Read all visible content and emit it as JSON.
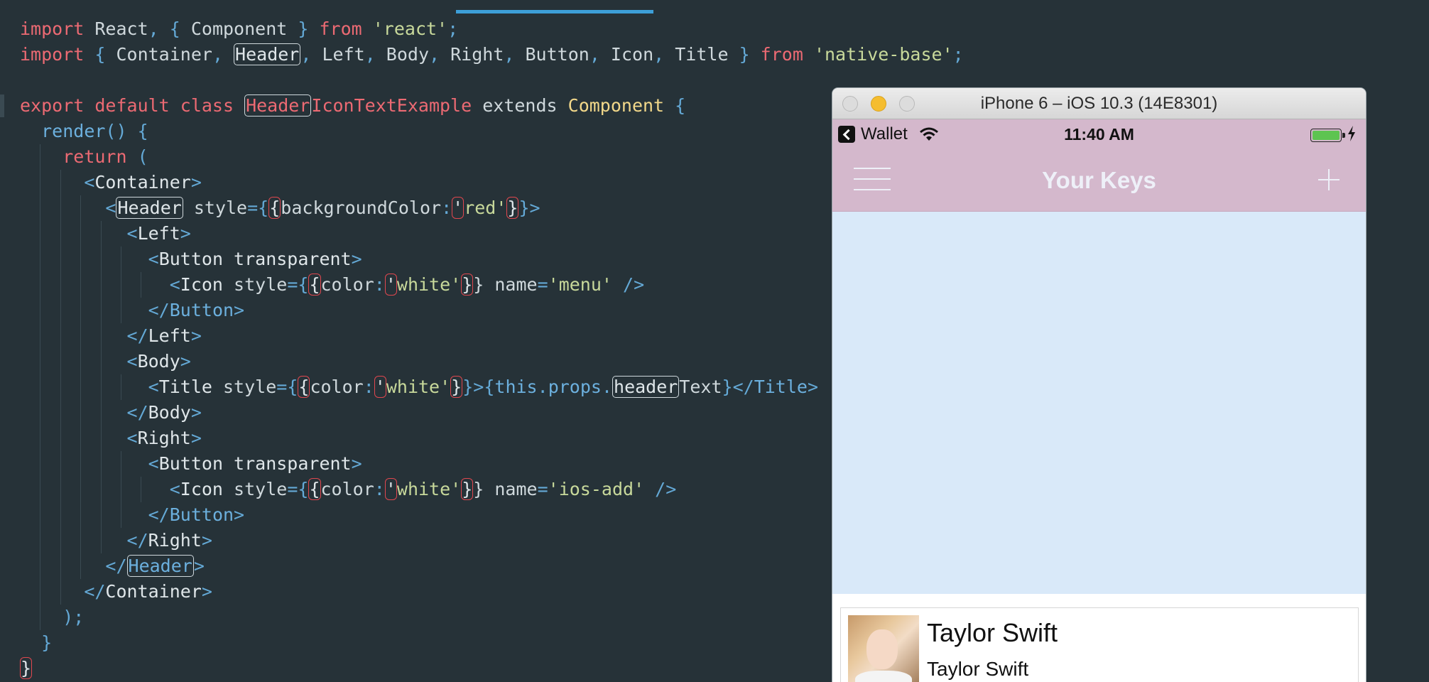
{
  "editor": {
    "lines": [
      [
        [
          "kw",
          "import"
        ],
        [
          "tx",
          " React"
        ],
        [
          "pun",
          ", { "
        ],
        [
          "tx",
          "Component"
        ],
        [
          "pun",
          " } "
        ],
        [
          "kw",
          "from"
        ],
        [
          "tx",
          " "
        ],
        [
          "str",
          "'react'"
        ],
        [
          "pun",
          ";"
        ]
      ],
      [
        [
          "kw",
          "import"
        ],
        [
          "pun",
          " { "
        ],
        [
          "tx",
          "Container"
        ],
        [
          "pun",
          ", "
        ],
        [
          "box",
          "Header"
        ],
        [
          "pun",
          ", "
        ],
        [
          "tx",
          "Left"
        ],
        [
          "pun",
          ", "
        ],
        [
          "tx",
          "Body"
        ],
        [
          "pun",
          ", "
        ],
        [
          "tx",
          "Right"
        ],
        [
          "pun",
          ", "
        ],
        [
          "tx",
          "Button"
        ],
        [
          "pun",
          ", "
        ],
        [
          "tx",
          "Icon"
        ],
        [
          "pun",
          ", "
        ],
        [
          "tx",
          "Title"
        ],
        [
          "pun",
          " } "
        ],
        [
          "kw",
          "from"
        ],
        [
          "tx",
          " "
        ],
        [
          "str",
          "'native-base'"
        ],
        [
          "pun",
          ";"
        ]
      ],
      [],
      [
        [
          "kw",
          "export default class "
        ],
        [
          "hlbox",
          "Header"
        ],
        [
          "kw",
          "IconTextExample"
        ],
        [
          "tx",
          " extends "
        ],
        [
          "cls",
          "Component"
        ],
        [
          "pun",
          " {"
        ]
      ],
      [
        [
          "i1",
          ""
        ],
        [
          "fn",
          "render"
        ],
        [
          "pun",
          "() {"
        ]
      ],
      [
        [
          "i2",
          ""
        ],
        [
          "kw",
          "return"
        ],
        [
          "pun",
          " ("
        ]
      ],
      [
        [
          "i3",
          ""
        ],
        [
          "pun",
          "<"
        ],
        [
          "tag",
          "Container"
        ],
        [
          "pun",
          ">"
        ]
      ],
      [
        [
          "i4",
          ""
        ],
        [
          "pun",
          "<"
        ],
        [
          "box",
          "Header"
        ],
        [
          "tx",
          " style"
        ],
        [
          "pun",
          "="
        ],
        [
          "pun",
          "{"
        ],
        [
          "rbox",
          "{"
        ],
        [
          "tx",
          "backgroundColor"
        ],
        [
          "pun",
          ":"
        ],
        [
          "rbox",
          "'"
        ],
        [
          "str",
          "red"
        ],
        [
          "str",
          "'"
        ],
        [
          "rbox",
          "}"
        ],
        [
          "pun",
          "}>"
        ]
      ],
      [
        [
          "i5",
          ""
        ],
        [
          "pun",
          "<"
        ],
        [
          "tag",
          "Left"
        ],
        [
          "pun",
          ">"
        ]
      ],
      [
        [
          "i6",
          ""
        ],
        [
          "pun",
          "<"
        ],
        [
          "tag",
          "Button transparent"
        ],
        [
          "pun",
          ">"
        ]
      ],
      [
        [
          "i7",
          ""
        ],
        [
          "pun",
          "<"
        ],
        [
          "tag",
          "Icon"
        ],
        [
          "tx",
          " style"
        ],
        [
          "pun",
          "="
        ],
        [
          "pun",
          "{"
        ],
        [
          "rbox",
          "{"
        ],
        [
          "tx",
          "color"
        ],
        [
          "pun",
          ":"
        ],
        [
          "rbox",
          "'"
        ],
        [
          "str",
          "white"
        ],
        [
          "str",
          "'"
        ],
        [
          "rbox",
          "}"
        ],
        [
          "tx",
          "} name"
        ],
        [
          "pun",
          "="
        ],
        [
          "str",
          "'menu'"
        ],
        [
          "pun",
          " />"
        ]
      ],
      [
        [
          "i6",
          ""
        ],
        [
          "pun",
          "</"
        ],
        [
          "fn",
          "Button"
        ],
        [
          "pun",
          ">"
        ]
      ],
      [
        [
          "i5",
          ""
        ],
        [
          "pun",
          "</"
        ],
        [
          "tag",
          "Left"
        ],
        [
          "pun",
          ">"
        ]
      ],
      [
        [
          "i5",
          ""
        ],
        [
          "pun",
          "<"
        ],
        [
          "tag",
          "Body"
        ],
        [
          "pun",
          ">"
        ]
      ],
      [
        [
          "i6",
          ""
        ],
        [
          "pun",
          "<"
        ],
        [
          "tag",
          "Title"
        ],
        [
          "tx",
          " style"
        ],
        [
          "pun",
          "="
        ],
        [
          "pun",
          "{"
        ],
        [
          "rbox",
          "{"
        ],
        [
          "tx",
          "color"
        ],
        [
          "pun",
          ":"
        ],
        [
          "rbox",
          "'"
        ],
        [
          "str",
          "white"
        ],
        [
          "str",
          "'"
        ],
        [
          "rbox",
          "}"
        ],
        [
          "pun",
          "}>"
        ],
        [
          "pun",
          "{"
        ],
        [
          "fn",
          "this"
        ],
        [
          "pun",
          "."
        ],
        [
          "fn",
          "props"
        ],
        [
          "pun",
          "."
        ],
        [
          "box",
          "header"
        ],
        [
          "tx",
          "Text"
        ],
        [
          "pun",
          "}</"
        ],
        [
          "fn",
          "Title"
        ],
        [
          "pun",
          ">"
        ]
      ],
      [
        [
          "i5",
          ""
        ],
        [
          "pun",
          "</"
        ],
        [
          "tag",
          "Body"
        ],
        [
          "pun",
          ">"
        ]
      ],
      [
        [
          "i5",
          ""
        ],
        [
          "pun",
          "<"
        ],
        [
          "tag",
          "Right"
        ],
        [
          "pun",
          ">"
        ]
      ],
      [
        [
          "i6",
          ""
        ],
        [
          "pun",
          "<"
        ],
        [
          "tag",
          "Button transparent"
        ],
        [
          "pun",
          ">"
        ]
      ],
      [
        [
          "i7",
          ""
        ],
        [
          "pun",
          "<"
        ],
        [
          "tag",
          "Icon"
        ],
        [
          "tx",
          " style"
        ],
        [
          "pun",
          "="
        ],
        [
          "pun",
          "{"
        ],
        [
          "rbox",
          "{"
        ],
        [
          "tx",
          "color"
        ],
        [
          "pun",
          ":"
        ],
        [
          "rbox",
          "'"
        ],
        [
          "str",
          "white"
        ],
        [
          "str",
          "'"
        ],
        [
          "rbox",
          "}"
        ],
        [
          "tx",
          "} name"
        ],
        [
          "pun",
          "="
        ],
        [
          "str",
          "'ios-add'"
        ],
        [
          "pun",
          " />"
        ]
      ],
      [
        [
          "i6",
          ""
        ],
        [
          "pun",
          "</"
        ],
        [
          "fn",
          "Button"
        ],
        [
          "pun",
          ">"
        ]
      ],
      [
        [
          "i5",
          ""
        ],
        [
          "pun",
          "</"
        ],
        [
          "tag",
          "Right"
        ],
        [
          "pun",
          ">"
        ]
      ],
      [
        [
          "i4",
          ""
        ],
        [
          "pun",
          "</"
        ],
        [
          "fbox",
          "Header"
        ],
        [
          "pun",
          ">"
        ]
      ],
      [
        [
          "i3",
          ""
        ],
        [
          "pun",
          "</"
        ],
        [
          "tag",
          "Container"
        ],
        [
          "pun",
          ">"
        ]
      ],
      [
        [
          "i2",
          ""
        ],
        [
          "pun",
          ");"
        ]
      ],
      [
        [
          "i1",
          ""
        ],
        [
          "pun",
          "}"
        ]
      ],
      [
        [
          "rbox",
          "}"
        ]
      ]
    ]
  },
  "simulator": {
    "window_title": "iPhone 6 – iOS 10.3 (14E8301)",
    "status": {
      "back_app": "Wallet",
      "time": "11:40 AM"
    },
    "navbar": {
      "title": "Your Keys",
      "left_icon": "menu-icon",
      "right_icon": "add-icon"
    },
    "colors": {
      "header": "#d4b8cc",
      "content": "#d9e9f9",
      "battery": "#5ec451"
    },
    "card": {
      "title": "Taylor Swift",
      "subtitle": "Taylor Swift"
    }
  }
}
